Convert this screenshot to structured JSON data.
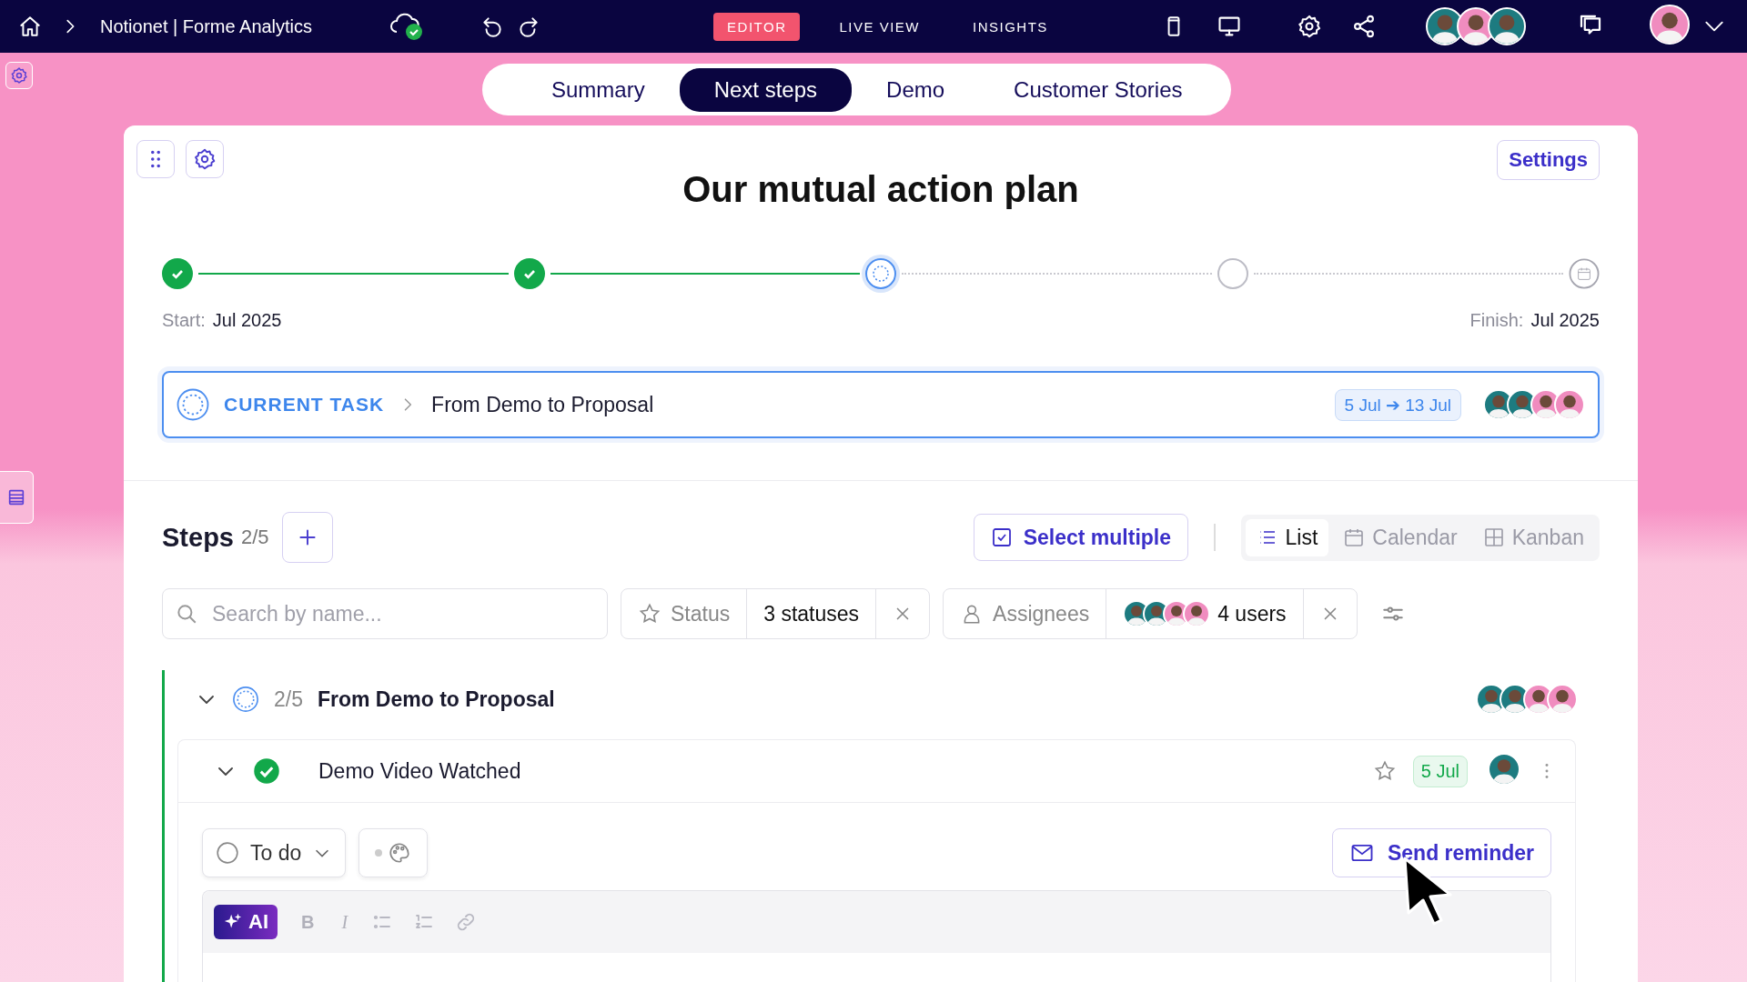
{
  "topbar": {
    "breadcrumb": "Notionet | Forme Analytics",
    "modes": [
      {
        "label": "EDITOR",
        "selected": true
      },
      {
        "label": "LIVE VIEW",
        "selected": false
      },
      {
        "label": "INSIGHTS",
        "selected": false
      }
    ],
    "collaborators": [
      {
        "color": "#1d7b80"
      },
      {
        "color": "#f08cbf"
      },
      {
        "color": "#1d7b80"
      }
    ],
    "user": {
      "color": "#f08cbf"
    }
  },
  "tabs": [
    {
      "label": "Summary",
      "selected": false
    },
    {
      "label": "Next steps",
      "selected": true
    },
    {
      "label": "Demo",
      "selected": false
    },
    {
      "label": "Customer Stories",
      "selected": false
    }
  ],
  "plan": {
    "title": "Our mutual action plan",
    "settings": "Settings",
    "milestones": [
      {
        "kind": "done"
      },
      {
        "kind": "done"
      },
      {
        "kind": "current"
      },
      {
        "kind": "pending"
      },
      {
        "kind": "finish"
      }
    ],
    "start": {
      "label": "Start:",
      "value": "Jul 2025"
    },
    "finish": {
      "label": "Finish:",
      "value": "Jul 2025"
    },
    "current_task": {
      "label": "CURRENT TASK",
      "title": "From Demo to Proposal",
      "dates": "5 Jul ➔ 13 Jul",
      "assignees": [
        {
          "color": "#1d7b80"
        },
        {
          "color": "#1d7b80"
        },
        {
          "color": "#f08cbf"
        },
        {
          "color": "#f08cbf"
        }
      ]
    }
  },
  "steps": {
    "title": "Steps",
    "count": "2/5",
    "select_multiple": "Select multiple",
    "views": [
      {
        "kind": "list",
        "label": "List",
        "selected": true
      },
      {
        "kind": "calendar",
        "label": "Calendar",
        "selected": false
      },
      {
        "kind": "kanban",
        "label": "Kanban",
        "selected": false
      }
    ],
    "search": {
      "placeholder": "Search by name..."
    },
    "status_filter": {
      "label": "Status",
      "value": "3 statuses"
    },
    "assignee_filter": {
      "label": "Assignees",
      "value": "4 users",
      "avatars": [
        {
          "color": "#1d7b80"
        },
        {
          "color": "#1d7b80"
        },
        {
          "color": "#f08cbf"
        },
        {
          "color": "#f08cbf"
        }
      ]
    },
    "group": {
      "expanded": true,
      "count": "2/5",
      "title": "From Demo to Proposal",
      "assignees": [
        {
          "color": "#1d7b80"
        },
        {
          "color": "#1d7b80"
        },
        {
          "color": "#f08cbf"
        },
        {
          "color": "#f08cbf"
        }
      ],
      "step": {
        "expanded": true,
        "done": true,
        "title": "Demo Video Watched",
        "starred": false,
        "date": "5 Jul",
        "assignee": {
          "color": "#1d7b80"
        },
        "status": "To do",
        "reminder": "Send reminder",
        "toolbar": [
          {
            "kind": "ai",
            "label": "AI"
          },
          {
            "kind": "bold",
            "label": "B"
          },
          {
            "kind": "italic",
            "label": "I"
          },
          {
            "kind": "bullets"
          },
          {
            "kind": "numbers"
          },
          {
            "kind": "link"
          }
        ]
      }
    }
  }
}
